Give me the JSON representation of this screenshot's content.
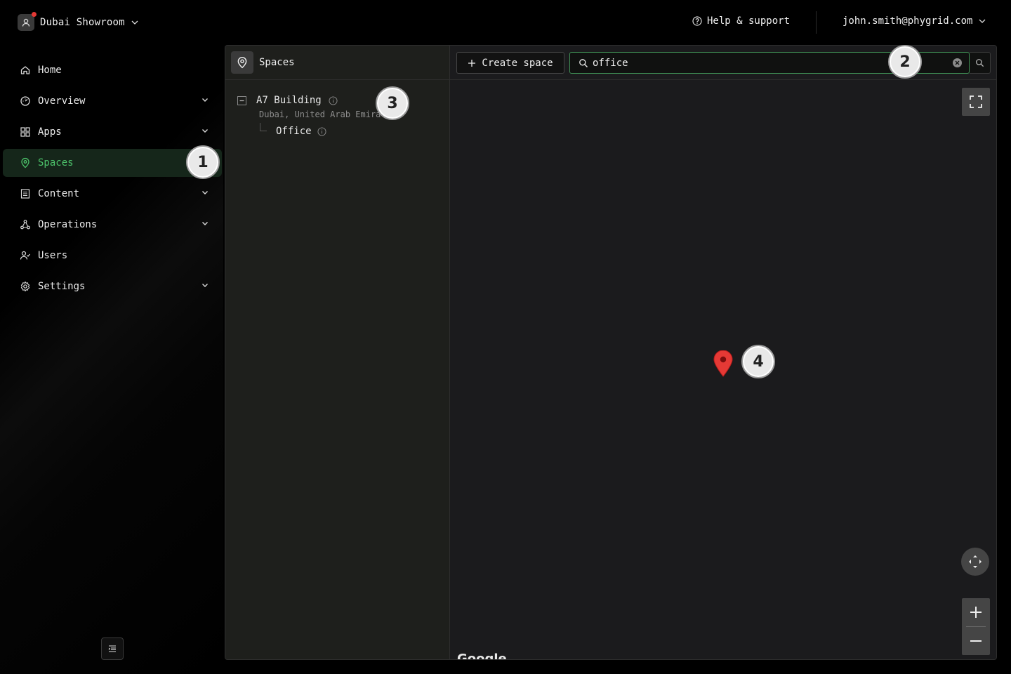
{
  "header": {
    "org_name": "Dubai Showroom",
    "help_label": "Help & support",
    "user_email": "john.smith@phygrid.com"
  },
  "sidebar": {
    "items": [
      {
        "label": "Home",
        "icon": "home-icon",
        "has_children": false
      },
      {
        "label": "Overview",
        "icon": "gauge-icon",
        "has_children": true
      },
      {
        "label": "Apps",
        "icon": "grid-icon",
        "has_children": true
      },
      {
        "label": "Spaces",
        "icon": "location-pin-icon",
        "has_children": false,
        "active": true
      },
      {
        "label": "Content",
        "icon": "list-icon",
        "has_children": true
      },
      {
        "label": "Operations",
        "icon": "network-icon",
        "has_children": true
      },
      {
        "label": "Users",
        "icon": "users-icon",
        "has_children": false
      },
      {
        "label": "Settings",
        "icon": "gear-icon",
        "has_children": true
      }
    ]
  },
  "spaces": {
    "title": "Spaces",
    "tree": {
      "name": "A7 Building",
      "subtitle": "Dubai, United Arab Emirates",
      "children": [
        {
          "name": "Office"
        }
      ]
    }
  },
  "toolbar": {
    "create_label": "Create space",
    "search_value": "office"
  },
  "map": {
    "attribution": "Google"
  },
  "callouts": [
    "1",
    "2",
    "3",
    "4"
  ],
  "colors": {
    "accent": "#4cc26a",
    "active_bg": "#15261a",
    "pin": "#e53935"
  }
}
